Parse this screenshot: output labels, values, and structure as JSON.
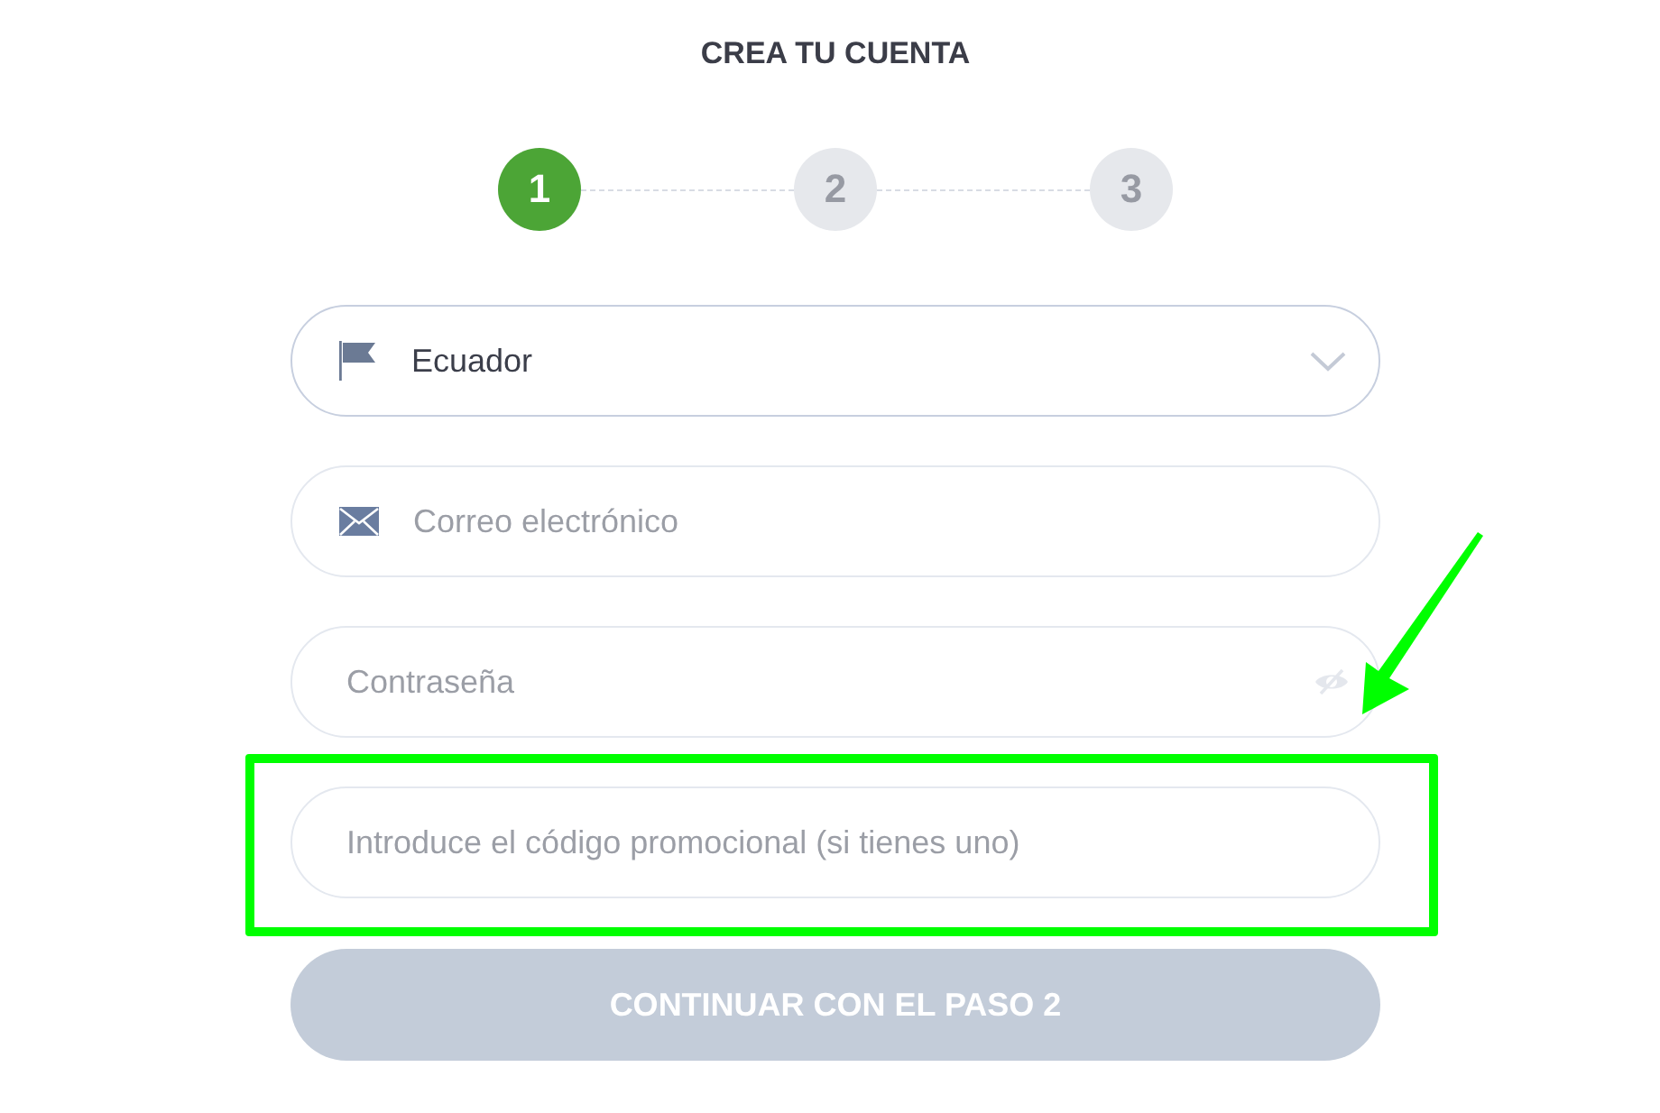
{
  "title": "CREA TU CUENTA",
  "steps": [
    {
      "label": "1",
      "selected": true
    },
    {
      "label": "2",
      "selected": false
    },
    {
      "label": "3",
      "selected": false
    }
  ],
  "fields": [
    {
      "kind": "select",
      "value": "Ecuador",
      "highlighted": false
    },
    {
      "kind": "email",
      "placeholder": "Correo electrónico",
      "highlighted": false
    },
    {
      "kind": "password",
      "placeholder": "Contraseña",
      "highlighted": false
    },
    {
      "kind": "text",
      "placeholder": "Introduce el código promocional (si tienes uno)",
      "highlighted": true
    }
  ],
  "submit": {
    "label": "CONTINUAR CON EL PASO 2",
    "disabled": true
  }
}
